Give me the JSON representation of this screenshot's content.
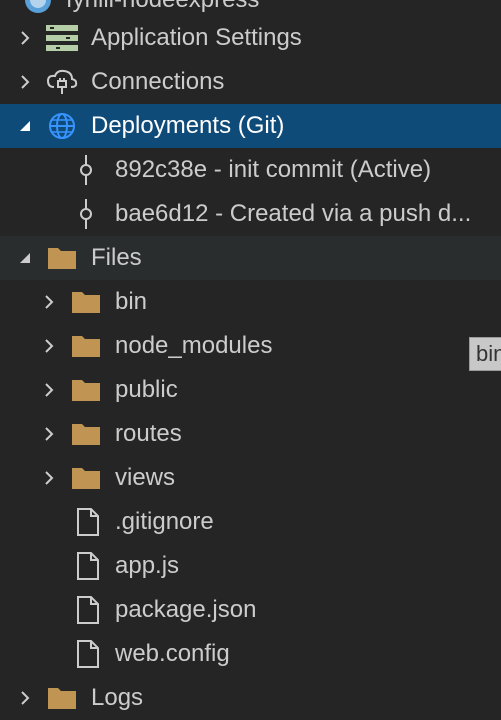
{
  "tree": {
    "root_label": "fyhlll-nodeexpress",
    "application_settings": "Application Settings",
    "connections": "Connections",
    "deployments": "Deployments (Git)",
    "commits": [
      "892c38e - init commit (Active)",
      "bae6d12 - Created via a push d..."
    ],
    "files": "Files",
    "folders": [
      "bin",
      "node_modules",
      "public",
      "routes",
      "views"
    ],
    "file_items": [
      ".gitignore",
      "app.js",
      "package.json",
      "web.config"
    ],
    "logs": "Logs"
  },
  "tooltip": {
    "text": "bin"
  },
  "colors": {
    "background": "#252526",
    "selected": "#0f4b78",
    "folder": "#c09553",
    "globe": "#3794ff"
  }
}
